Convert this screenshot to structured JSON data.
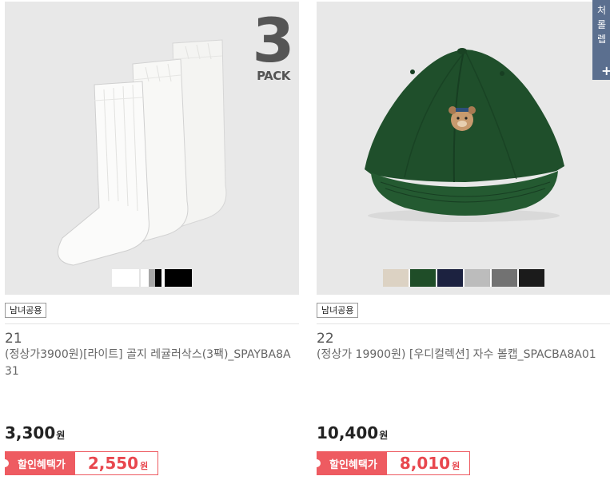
{
  "products": [
    {
      "pack_badge": {
        "number": "3",
        "text": "PACK"
      },
      "gender_tag": "남녀공용",
      "number": "21",
      "name": "(정상가3900원)[라이트] 골지 레귤러삭스(3팩)_SPAYBA8A31",
      "price": "3,300",
      "won": "원",
      "discount_label": "할인혜택가",
      "discount_price": "2,550",
      "swatches": [
        {
          "color": "#ffffff",
          "w": 34
        },
        {
          "color": "#e4e4e4",
          "w": 2
        },
        {
          "color": "#ffffff",
          "w": 10
        },
        {
          "color": "#a6a6a6",
          "w": 8
        },
        {
          "color": "#000000",
          "w": 8
        },
        {
          "color": "#ffffff",
          "w": 4
        },
        {
          "color": "#000000",
          "w": 34
        }
      ]
    },
    {
      "gender_tag": "남녀공용",
      "number": "22",
      "name": "(정상가 19900원) [우디컬렉션] 자수 볼캡_SPACBA8A01",
      "price": "10,400",
      "won": "원",
      "discount_label": "할인혜택가",
      "discount_price": "8,010",
      "swatches": [
        {
          "color": "#dcd2c3",
          "w": 32
        },
        {
          "color": "#ffffff",
          "w": 2
        },
        {
          "color": "#1f4d28",
          "w": 32
        },
        {
          "color": "#ffffff",
          "w": 2
        },
        {
          "color": "#1c2240",
          "w": 32
        },
        {
          "color": "#ffffff",
          "w": 2
        },
        {
          "color": "#bcbcbc",
          "w": 32
        },
        {
          "color": "#ffffff",
          "w": 2
        },
        {
          "color": "#727272",
          "w": 32
        },
        {
          "color": "#ffffff",
          "w": 2
        },
        {
          "color": "#1b1b1b",
          "w": 32
        }
      ]
    }
  ],
  "side_tab": {
    "text": "처 롤 렙",
    "plus": "+"
  },
  "colors": {
    "accent": "#ee5b61",
    "sidebar": "#5b6f8f"
  }
}
